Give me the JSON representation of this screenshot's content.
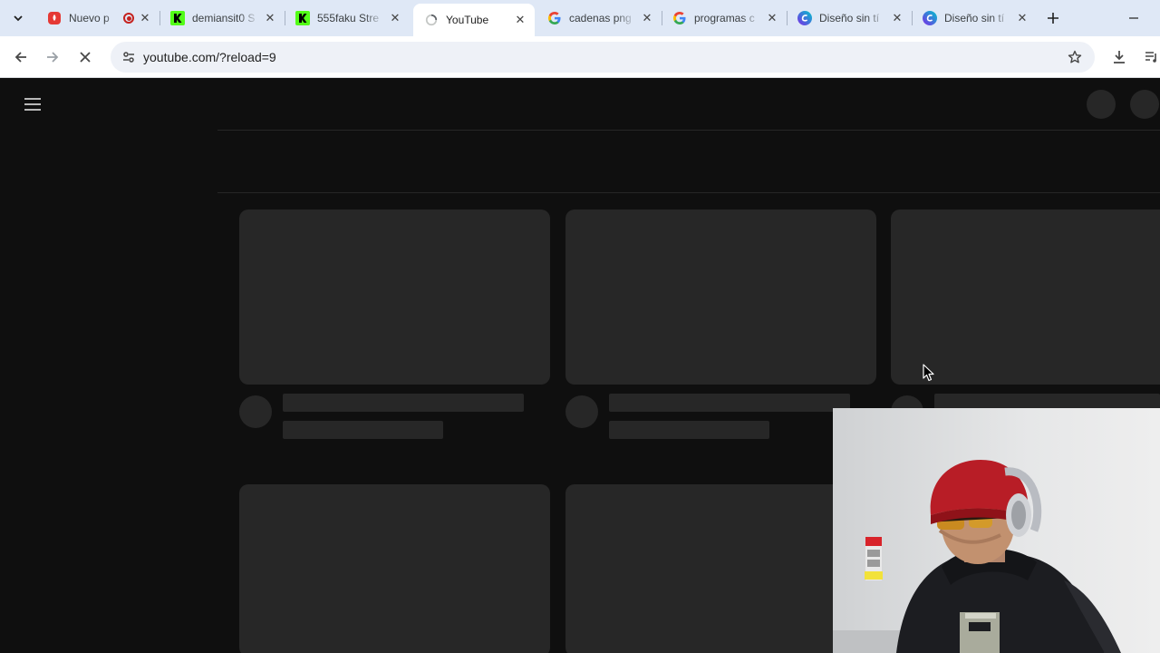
{
  "browser": {
    "tabs": [
      {
        "title": "Nuevo p",
        "favicon": "red-app-icon",
        "active": false
      },
      {
        "title": "demiansit0 S",
        "favicon": "kick-icon",
        "active": false
      },
      {
        "title": "555faku Stre",
        "favicon": "kick-icon",
        "active": false
      },
      {
        "title": "YouTube",
        "favicon": "loading-icon",
        "active": true
      },
      {
        "title": "cadenas png",
        "favicon": "google-icon",
        "active": false
      },
      {
        "title": "programas c",
        "favicon": "google-icon",
        "active": false
      },
      {
        "title": "Diseño sin tí",
        "favicon": "canva-icon",
        "active": false
      },
      {
        "title": "Diseño sin tí",
        "favicon": "canva-icon",
        "active": false
      }
    ],
    "url": "youtube.com/?reload=9",
    "colors": {
      "tabstrip": "#dfe8f6",
      "page_bg": "#0f0f0f",
      "skeleton": "#272727",
      "recording": "#c5221f",
      "kick_green": "#53fc18"
    }
  }
}
